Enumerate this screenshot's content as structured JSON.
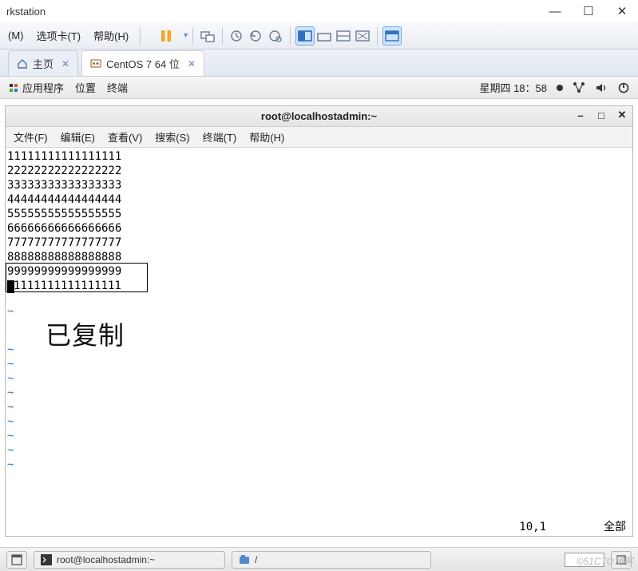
{
  "app": {
    "title": "rkstation"
  },
  "window_controls": {
    "min": "—",
    "max": "☐",
    "close": "✕"
  },
  "menubar": {
    "item1": "(M)",
    "item2": "选项卡(T)",
    "item3": "帮助(H)"
  },
  "tabs": {
    "home": {
      "label": "主页"
    },
    "vm": {
      "label": "CentOS 7 64 位"
    },
    "close_glyph": "✕"
  },
  "gnome": {
    "apps": "应用程序",
    "places": "位置",
    "terminal": "终端",
    "datetime": "星期四 18：58",
    "tray": {
      "net": "network-icon",
      "vol": "volume-icon",
      "power": "power-icon"
    }
  },
  "term": {
    "title": "root@localhostadmin:~",
    "menu": {
      "file": "文件(F)",
      "edit": "编辑(E)",
      "view": "查看(V)",
      "search": "搜索(S)",
      "terminal": "终端(T)",
      "help": "帮助(H)"
    },
    "lines": [
      "11111111111111111",
      "22222222222222222",
      "33333333333333333",
      "44444444444444444",
      "55555555555555555",
      "66666666666666666",
      "77777777777777777",
      "88888888888888888",
      "99999999999999999",
      "1111111111111111"
    ],
    "annotation": "已复制",
    "status_pos": "10,1",
    "status_scope": "全部"
  },
  "taskbar": {
    "task1": "root@localhostadmin:~",
    "path": "/"
  },
  "watermark": "51CTO博客"
}
